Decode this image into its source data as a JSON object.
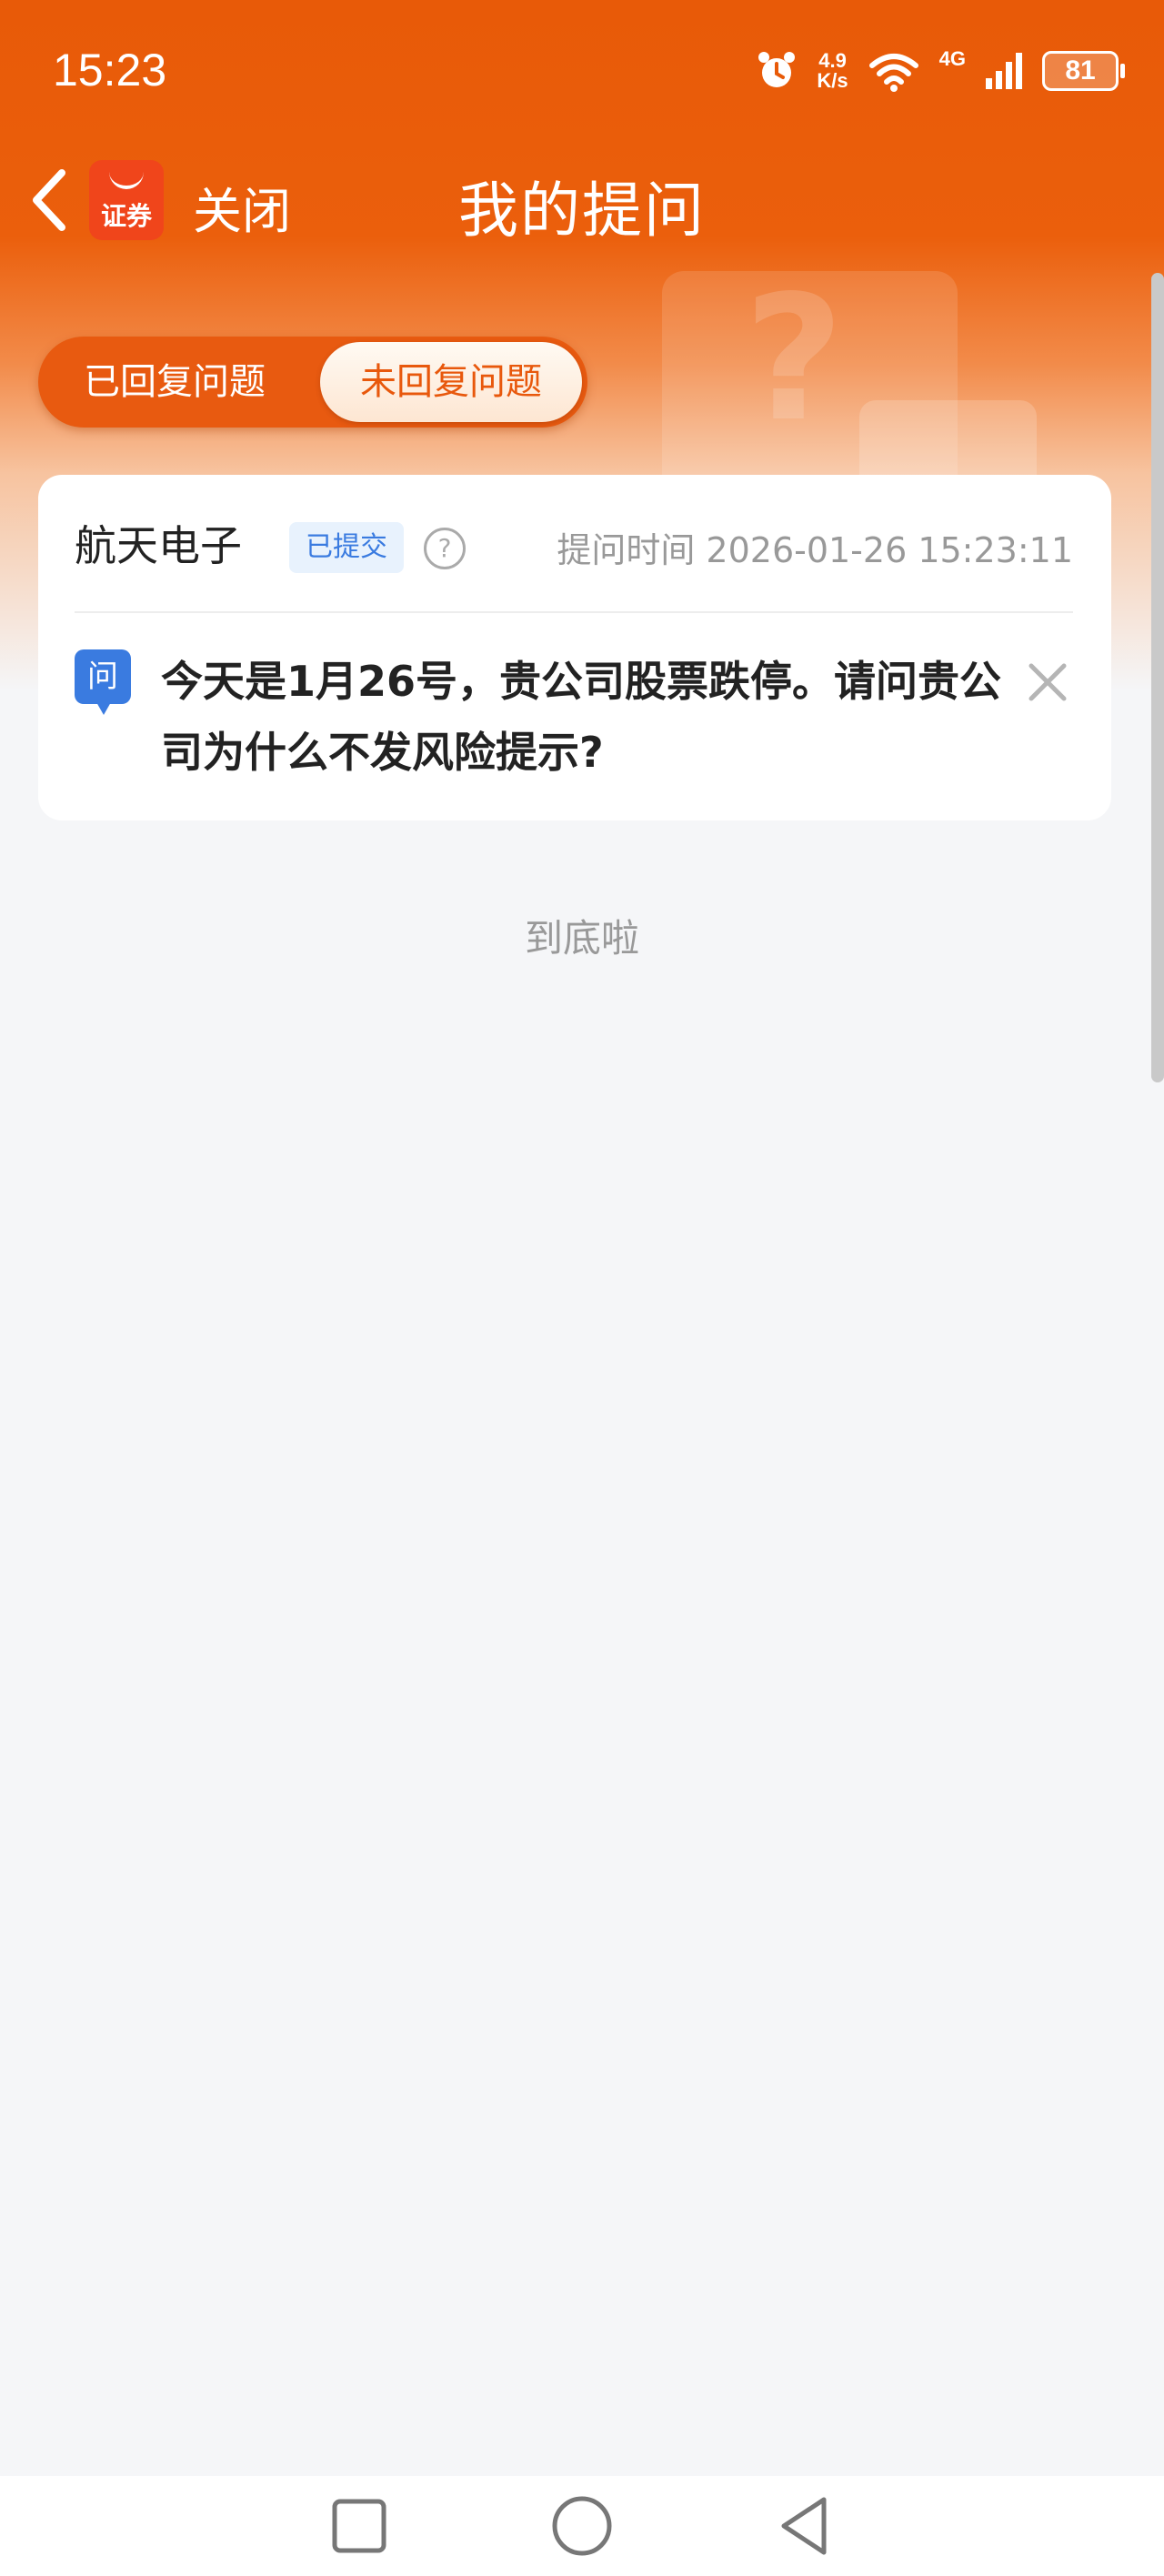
{
  "status_bar": {
    "time": "15:23",
    "net_speed_value": "4.9",
    "net_speed_unit": "K/s",
    "network": "4G",
    "battery": "81",
    "icons": [
      "alarm-icon",
      "wifi-icon",
      "signal-icon",
      "battery-icon"
    ]
  },
  "header": {
    "back_icon": "chevron-left-icon",
    "app_logo_text": "证券",
    "close_label": "关闭",
    "title": "我的提问"
  },
  "tabs": [
    {
      "label": "已回复问题",
      "active": false
    },
    {
      "label": "未回复问题",
      "active": true
    }
  ],
  "question_card": {
    "company": "航天电子",
    "status": "已提交",
    "ask_time": "提问时间 2026-01-26 15:23:11",
    "question_icon_label": "问",
    "question_text": "今天是1月26号，贵公司股票跌停。请问贵公司为什么不发风险提示?"
  },
  "end_text": "到底啦",
  "colors": {
    "brand_orange": "#e85a08",
    "accent_blue": "#3a7be0",
    "background": "#f5f6f8"
  },
  "nav_bar": {
    "icons": [
      "recent-apps-icon",
      "home-icon",
      "back-icon"
    ]
  }
}
